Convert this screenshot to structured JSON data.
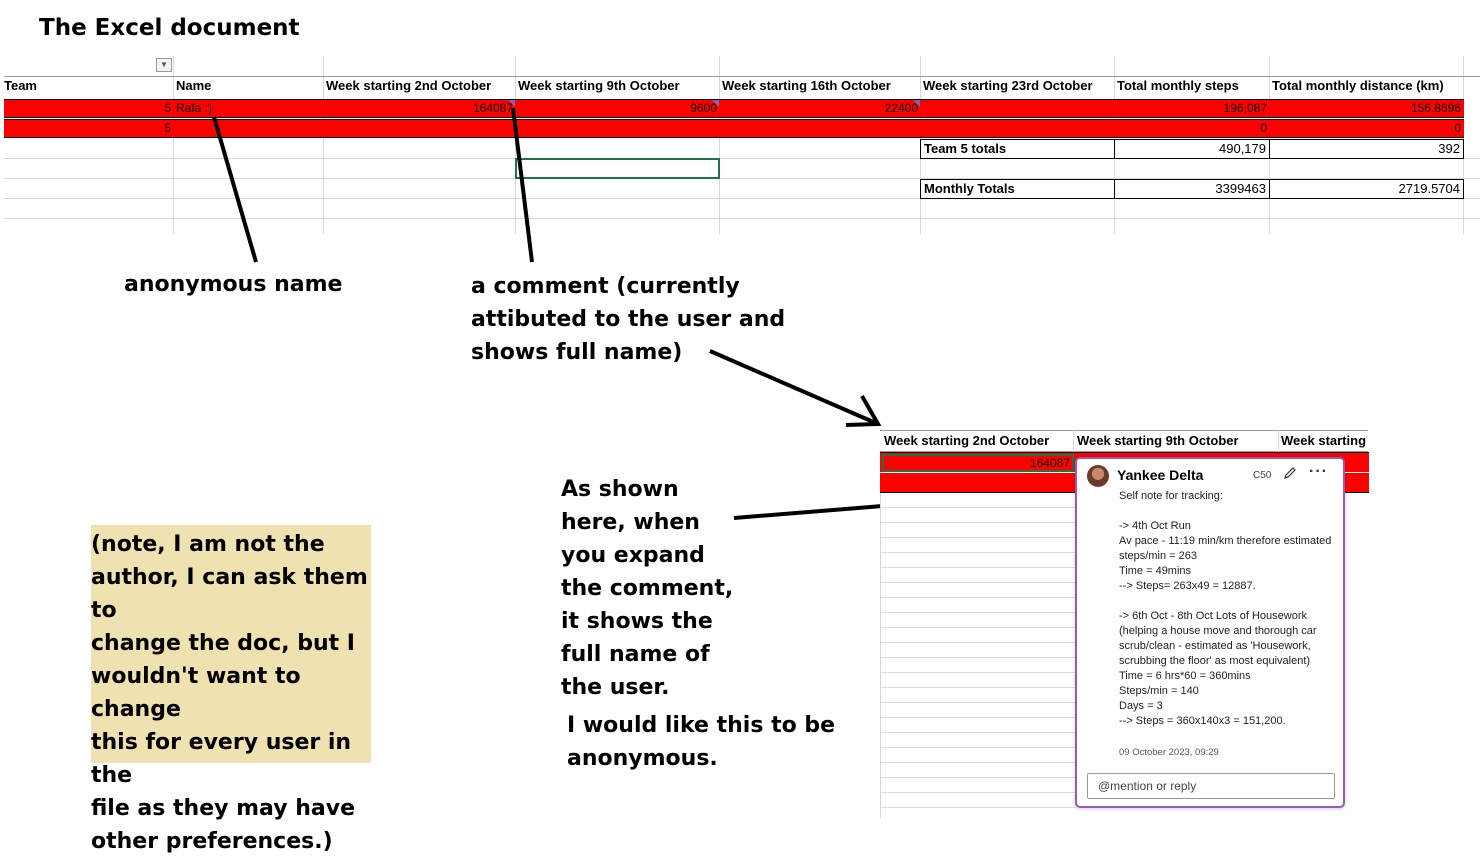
{
  "title": "The Excel document",
  "sheet": {
    "headers": [
      "Team",
      "Name",
      "Week starting 2nd October",
      "Week starting 9th October",
      "Week starting 16th October",
      "Week starting 23rd October",
      "Total monthly steps",
      "Total monthly distance (km)"
    ],
    "row1": {
      "team": "5",
      "name": "Rafa :)",
      "w1": "164087",
      "w2": "9600",
      "w3": "22400",
      "w4": "",
      "steps": "196,087",
      "distance": "156.8696"
    },
    "row2": {
      "team": "5",
      "name": "",
      "steps": "0",
      "distance": "0"
    },
    "team_totals": {
      "label": "Team 5 totals",
      "steps": "490,179",
      "distance": "392"
    },
    "monthly_totals": {
      "label": "Monthly Totals",
      "steps": "3399463",
      "distance": "2719.5704"
    }
  },
  "annotations": {
    "anon_name": "anonymous name",
    "comment_line1": "a comment (currently",
    "comment_line2": "attibuted to the user and",
    "comment_line3": "shows full name)",
    "expand_lines": [
      "As shown",
      "here, when",
      "you expand",
      "the comment,",
      "it shows the",
      "full name of",
      "the user."
    ],
    "wish_line1": "I would like this to be",
    "wish_line2": "anonymous."
  },
  "note_lines": [
    "(note, I am not the",
    "author, I can ask them to",
    "change the doc, but I",
    "wouldn't want to change",
    "this for every user in the",
    "file as they may have",
    "other preferences.)"
  ],
  "inset": {
    "headers": [
      "Week starting 2nd October",
      "Week starting 9th October",
      "Week starting"
    ],
    "value": "164087"
  },
  "comment": {
    "author": "Yankee Delta",
    "cell_ref": "C50",
    "body": "Self note for tracking:\n\n-> 4th Oct Run\nAv pace - 11:19 min/km therefore estimated steps/min = 263\nTime = 49mins\n--> Steps= 263x49 = 12887.\n\n-> 6th Oct - 8th Oct Lots of Housework (helping a house move and thorough car scrub/clean - estimated as 'Housework, scrubbing the floor' as most equivalent)\nTime = 6 hrs*60 = 360mins\nSteps/min = 140\nDays = 3\n--> Steps = 360x140x3 = 151,200.",
    "date": "09 October 2023, 09:29",
    "reply_placeholder": "@mention or reply",
    "edit_icon": "pencil-icon",
    "more_icon": "more-icon"
  },
  "colors": {
    "row_fill": "#ff0000",
    "card_border": "#9b59b6",
    "note_bg": "#efe1b0",
    "selection": "#217346"
  }
}
